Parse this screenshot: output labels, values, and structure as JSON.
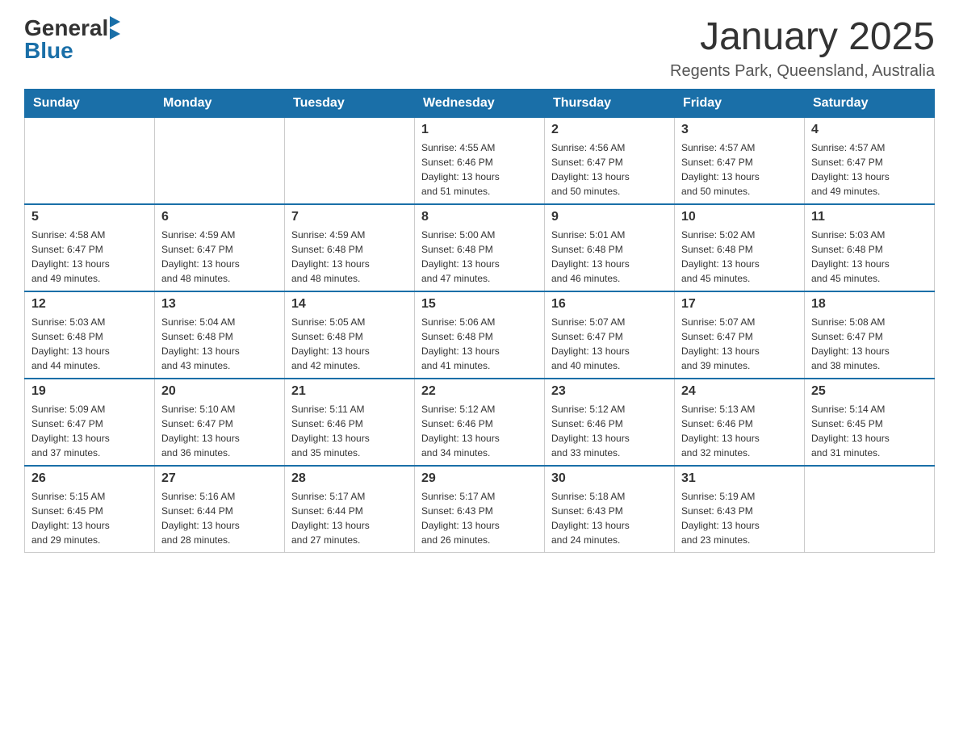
{
  "header": {
    "logo": {
      "general": "General",
      "blue": "Blue"
    },
    "title": "January 2025",
    "location": "Regents Park, Queensland, Australia"
  },
  "days_of_week": [
    "Sunday",
    "Monday",
    "Tuesday",
    "Wednesday",
    "Thursday",
    "Friday",
    "Saturday"
  ],
  "weeks": [
    [
      {
        "day": "",
        "info": ""
      },
      {
        "day": "",
        "info": ""
      },
      {
        "day": "",
        "info": ""
      },
      {
        "day": "1",
        "info": "Sunrise: 4:55 AM\nSunset: 6:46 PM\nDaylight: 13 hours\nand 51 minutes."
      },
      {
        "day": "2",
        "info": "Sunrise: 4:56 AM\nSunset: 6:47 PM\nDaylight: 13 hours\nand 50 minutes."
      },
      {
        "day": "3",
        "info": "Sunrise: 4:57 AM\nSunset: 6:47 PM\nDaylight: 13 hours\nand 50 minutes."
      },
      {
        "day": "4",
        "info": "Sunrise: 4:57 AM\nSunset: 6:47 PM\nDaylight: 13 hours\nand 49 minutes."
      }
    ],
    [
      {
        "day": "5",
        "info": "Sunrise: 4:58 AM\nSunset: 6:47 PM\nDaylight: 13 hours\nand 49 minutes."
      },
      {
        "day": "6",
        "info": "Sunrise: 4:59 AM\nSunset: 6:47 PM\nDaylight: 13 hours\nand 48 minutes."
      },
      {
        "day": "7",
        "info": "Sunrise: 4:59 AM\nSunset: 6:48 PM\nDaylight: 13 hours\nand 48 minutes."
      },
      {
        "day": "8",
        "info": "Sunrise: 5:00 AM\nSunset: 6:48 PM\nDaylight: 13 hours\nand 47 minutes."
      },
      {
        "day": "9",
        "info": "Sunrise: 5:01 AM\nSunset: 6:48 PM\nDaylight: 13 hours\nand 46 minutes."
      },
      {
        "day": "10",
        "info": "Sunrise: 5:02 AM\nSunset: 6:48 PM\nDaylight: 13 hours\nand 45 minutes."
      },
      {
        "day": "11",
        "info": "Sunrise: 5:03 AM\nSunset: 6:48 PM\nDaylight: 13 hours\nand 45 minutes."
      }
    ],
    [
      {
        "day": "12",
        "info": "Sunrise: 5:03 AM\nSunset: 6:48 PM\nDaylight: 13 hours\nand 44 minutes."
      },
      {
        "day": "13",
        "info": "Sunrise: 5:04 AM\nSunset: 6:48 PM\nDaylight: 13 hours\nand 43 minutes."
      },
      {
        "day": "14",
        "info": "Sunrise: 5:05 AM\nSunset: 6:48 PM\nDaylight: 13 hours\nand 42 minutes."
      },
      {
        "day": "15",
        "info": "Sunrise: 5:06 AM\nSunset: 6:48 PM\nDaylight: 13 hours\nand 41 minutes."
      },
      {
        "day": "16",
        "info": "Sunrise: 5:07 AM\nSunset: 6:47 PM\nDaylight: 13 hours\nand 40 minutes."
      },
      {
        "day": "17",
        "info": "Sunrise: 5:07 AM\nSunset: 6:47 PM\nDaylight: 13 hours\nand 39 minutes."
      },
      {
        "day": "18",
        "info": "Sunrise: 5:08 AM\nSunset: 6:47 PM\nDaylight: 13 hours\nand 38 minutes."
      }
    ],
    [
      {
        "day": "19",
        "info": "Sunrise: 5:09 AM\nSunset: 6:47 PM\nDaylight: 13 hours\nand 37 minutes."
      },
      {
        "day": "20",
        "info": "Sunrise: 5:10 AM\nSunset: 6:47 PM\nDaylight: 13 hours\nand 36 minutes."
      },
      {
        "day": "21",
        "info": "Sunrise: 5:11 AM\nSunset: 6:46 PM\nDaylight: 13 hours\nand 35 minutes."
      },
      {
        "day": "22",
        "info": "Sunrise: 5:12 AM\nSunset: 6:46 PM\nDaylight: 13 hours\nand 34 minutes."
      },
      {
        "day": "23",
        "info": "Sunrise: 5:12 AM\nSunset: 6:46 PM\nDaylight: 13 hours\nand 33 minutes."
      },
      {
        "day": "24",
        "info": "Sunrise: 5:13 AM\nSunset: 6:46 PM\nDaylight: 13 hours\nand 32 minutes."
      },
      {
        "day": "25",
        "info": "Sunrise: 5:14 AM\nSunset: 6:45 PM\nDaylight: 13 hours\nand 31 minutes."
      }
    ],
    [
      {
        "day": "26",
        "info": "Sunrise: 5:15 AM\nSunset: 6:45 PM\nDaylight: 13 hours\nand 29 minutes."
      },
      {
        "day": "27",
        "info": "Sunrise: 5:16 AM\nSunset: 6:44 PM\nDaylight: 13 hours\nand 28 minutes."
      },
      {
        "day": "28",
        "info": "Sunrise: 5:17 AM\nSunset: 6:44 PM\nDaylight: 13 hours\nand 27 minutes."
      },
      {
        "day": "29",
        "info": "Sunrise: 5:17 AM\nSunset: 6:43 PM\nDaylight: 13 hours\nand 26 minutes."
      },
      {
        "day": "30",
        "info": "Sunrise: 5:18 AM\nSunset: 6:43 PM\nDaylight: 13 hours\nand 24 minutes."
      },
      {
        "day": "31",
        "info": "Sunrise: 5:19 AM\nSunset: 6:43 PM\nDaylight: 13 hours\nand 23 minutes."
      },
      {
        "day": "",
        "info": ""
      }
    ]
  ]
}
